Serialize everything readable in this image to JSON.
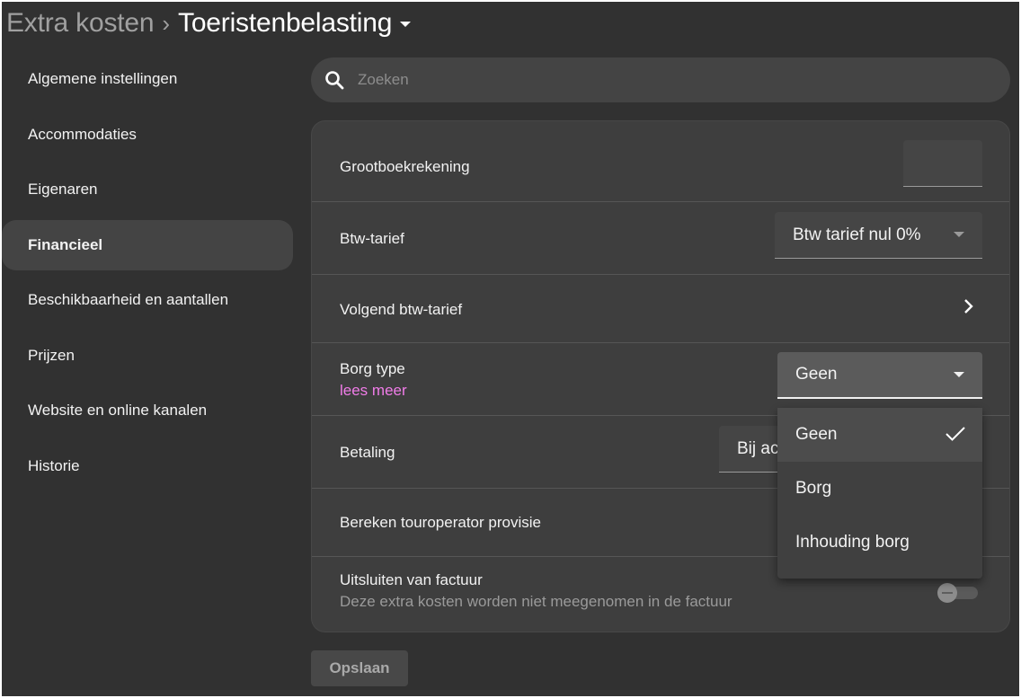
{
  "breadcrumb": {
    "parent": "Extra kosten",
    "separator": "›",
    "current": "Toeristenbelasting"
  },
  "sidebar": {
    "items": [
      {
        "label": "Algemene instellingen",
        "active": false
      },
      {
        "label": "Accommodaties",
        "active": false
      },
      {
        "label": "Eigenaren",
        "active": false
      },
      {
        "label": "Financieel",
        "active": true
      },
      {
        "label": "Beschikbaarheid en aantallen",
        "active": false
      },
      {
        "label": "Prijzen",
        "active": false
      },
      {
        "label": "Website en online kanalen",
        "active": false
      },
      {
        "label": "Historie",
        "active": false
      }
    ]
  },
  "search": {
    "placeholder": "Zoeken",
    "value": ""
  },
  "settings": {
    "grootboek": {
      "label": "Grootboekrekening",
      "value": ""
    },
    "btw": {
      "label": "Btw-tarief",
      "value": "Btw tarief nul 0%"
    },
    "volgend_btw": {
      "label": "Volgend btw-tarief"
    },
    "borg": {
      "label": "Borg type",
      "link": "lees meer",
      "value": "Geen"
    },
    "betaling": {
      "label": "Betaling",
      "value_visible": "Bij ac"
    },
    "touroperator": {
      "label": "Bereken touroperator provisie"
    },
    "uitsluiten": {
      "label": "Uitsluiten van factuur",
      "description": "Deze extra kosten worden niet meegenomen in de factuur",
      "enabled": false
    }
  },
  "borg_menu": {
    "options": [
      {
        "label": "Geen",
        "selected": true
      },
      {
        "label": "Borg",
        "selected": false
      },
      {
        "label": "Inhouding borg",
        "selected": false
      }
    ]
  },
  "actions": {
    "save_label": "Opslaan"
  },
  "colors": {
    "background": "#313131",
    "card": "#3e3e3e",
    "active_nav": "#444444",
    "link": "#f07ce8",
    "text": "#f2f2f2",
    "muted": "#9a9a9a"
  },
  "icons": {
    "search": "search-icon",
    "caret": "caret-down-icon",
    "chevron": "chevron-right-icon",
    "check": "check-icon"
  }
}
